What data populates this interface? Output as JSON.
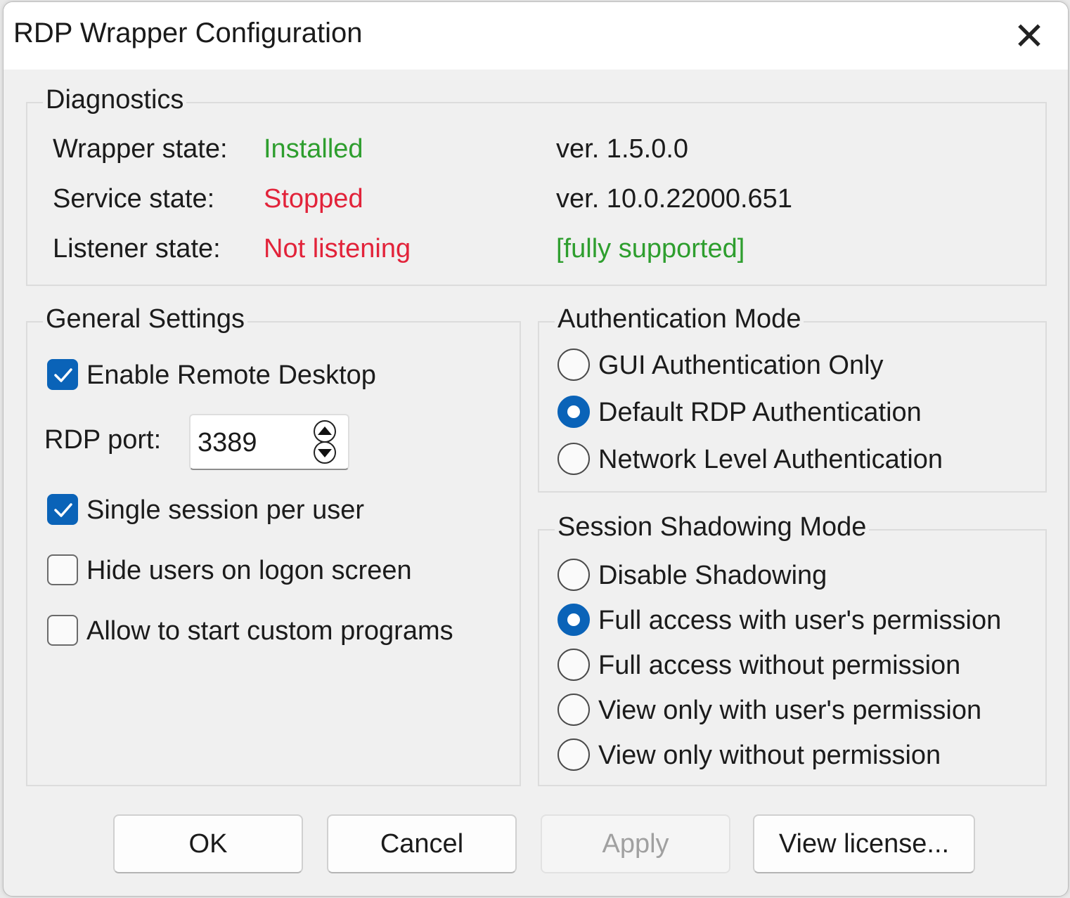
{
  "window": {
    "title": "RDP Wrapper Configuration",
    "close_symbol": "✕"
  },
  "diagnostics": {
    "label": "Diagnostics",
    "wrapper_label": "Wrapper state:",
    "wrapper_value": "Installed",
    "wrapper_version": "ver.  1.5.0.0",
    "service_label": "Service state:",
    "service_value": "Stopped",
    "service_version": "ver.  10.0.22000.651",
    "listener_label": "Listener state:",
    "listener_value": "Not listening",
    "support_status": "[fully supported]",
    "colors": {
      "ok": "#2e9e2e",
      "error": "#e2233a"
    }
  },
  "general": {
    "label": "General Settings",
    "enable_rdp": {
      "label": "Enable Remote Desktop",
      "checked": true
    },
    "port_label": "RDP port:",
    "port_value": "3389",
    "single_session": {
      "label": "Single session per user",
      "checked": true
    },
    "hide_users": {
      "label": "Hide users on logon screen",
      "checked": false
    },
    "custom_programs": {
      "label": "Allow to start custom programs",
      "checked": false
    }
  },
  "auth": {
    "label": "Authentication Mode",
    "options": [
      {
        "label": "GUI Authentication Only",
        "selected": false
      },
      {
        "label": "Default RDP Authentication",
        "selected": true
      },
      {
        "label": "Network Level Authentication",
        "selected": false
      }
    ]
  },
  "shadow": {
    "label": "Session Shadowing Mode",
    "options": [
      {
        "label": "Disable Shadowing",
        "selected": false
      },
      {
        "label": "Full access with user's permission",
        "selected": true
      },
      {
        "label": "Full access without permission",
        "selected": false
      },
      {
        "label": "View only with user's permission",
        "selected": false
      },
      {
        "label": "View only without permission",
        "selected": false
      }
    ]
  },
  "buttons": {
    "ok": "OK",
    "cancel": "Cancel",
    "apply": "Apply",
    "apply_enabled": false,
    "view_license": "View license..."
  },
  "accent_color": "#0a63b8"
}
